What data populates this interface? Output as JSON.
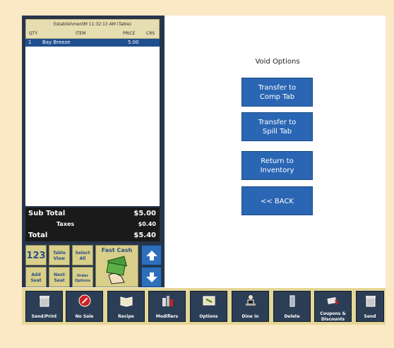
{
  "ticket": {
    "header_line": "EstablishmentM 11:32:13 AM (Table)",
    "columns": {
      "qty": "QTY",
      "item": "ITEM",
      "price": "PRICE",
      "crs": "CRS"
    },
    "items": [
      {
        "qty": "1",
        "item": "Bay Breeze",
        "price": "5.00"
      }
    ]
  },
  "totals": {
    "subtotal_label": "Sub Total",
    "subtotal_value": "$5.00",
    "taxes_label": "Taxes",
    "taxes_value": "$0.40",
    "total_label": "Total",
    "total_value": "$5.40"
  },
  "controls": {
    "numpad_label": "123",
    "table_view": [
      "Table",
      "View"
    ],
    "select_all": [
      "Select",
      "All"
    ],
    "add_seat": [
      "Add",
      "Seat"
    ],
    "next_seat": [
      "Next",
      "Seat"
    ],
    "order_options": [
      "Order",
      "Options"
    ],
    "fast_cash": "Fast Cash"
  },
  "void": {
    "title": "Void Options",
    "transfer_comp": [
      "Transfer to",
      "Comp Tab"
    ],
    "transfer_spill": [
      "Transfer to",
      "Spill Tab"
    ],
    "return_inventory": [
      "Return to",
      "Inventory"
    ],
    "back": "<< BACK"
  },
  "bottom_bar": [
    {
      "label": "Send/Print",
      "icon": "trash-can-icon"
    },
    {
      "label": "No Sale",
      "icon": "no-sale-icon"
    },
    {
      "label": "Recipe",
      "icon": "book-icon"
    },
    {
      "label": "Modifiers",
      "icon": "bottles-icon"
    },
    {
      "label": "Options",
      "icon": "options-icon"
    },
    {
      "label": "Dine In",
      "icon": "diner-icon"
    },
    {
      "label": "Delete",
      "icon": "delete-icon"
    },
    {
      "label": "Coupons &",
      "label2": "Discounts",
      "icon": "coupon-icon"
    },
    {
      "label": "Send",
      "icon": "trash-can-icon"
    }
  ],
  "colors": {
    "accent": "#2a66b3",
    "panel": "#26354a",
    "tan": "#d9cf8a",
    "background": "#fbe9c5"
  }
}
